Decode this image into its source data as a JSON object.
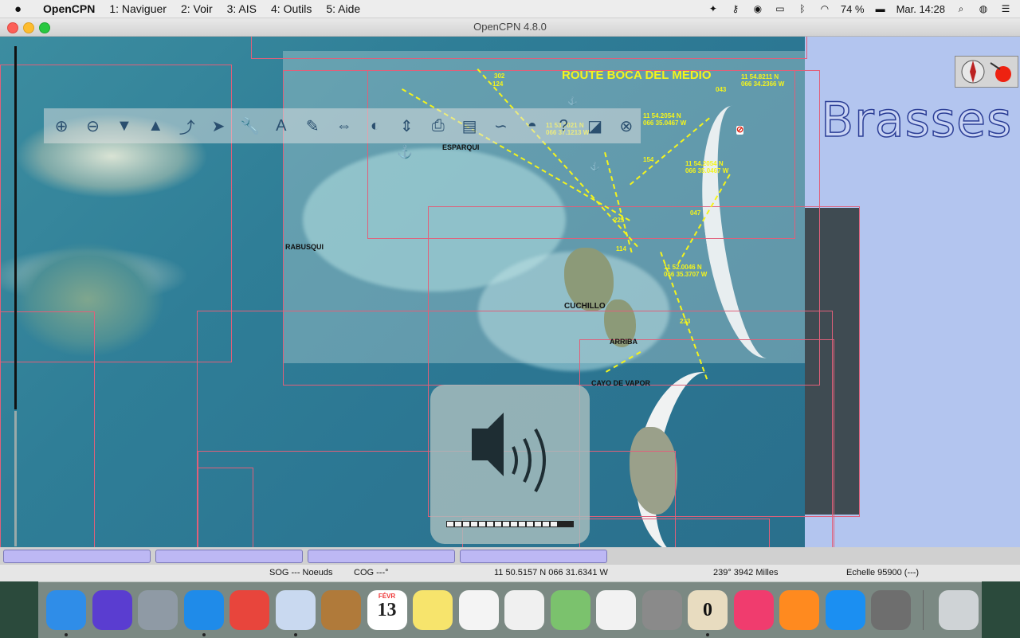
{
  "menubar": {
    "app_name": "OpenCPN",
    "items": [
      "1: Naviguer",
      "2: Voir",
      "3: AIS",
      "4: Outils",
      "5: Aide"
    ],
    "battery": "74 %",
    "clock": "Mar. 14:28"
  },
  "window": {
    "title": "OpenCPN 4.8.0"
  },
  "chart": {
    "route_name": "ROUTE BOCA DEL MEDIO",
    "depth_unit": "Brasses",
    "labels": {
      "esparqui": "ESPARQUI",
      "rabusqui": "RABUSQUI",
      "cuchillo": "CUCHILLO",
      "arriba": "ARRIBA",
      "cayo_de_vapor": "CAYO DE VAPOR"
    },
    "coords": [
      {
        "lat": "11 54.8211 N",
        "lon": "066 34.2366 W"
      },
      {
        "lat": "11 54.2054 N",
        "lon": "066 35.0467 W"
      },
      {
        "lat": "11 52.0046 N",
        "lon": "066 35.3707 W"
      },
      {
        "lat": "11 53.7021 N",
        "lon": "066 37.1213 W"
      },
      {
        "lat": "11 54.2054 N",
        "lon": "066 35.0467 W"
      }
    ],
    "leg_labels": [
      "302",
      "124",
      "225",
      "047",
      "114",
      "233",
      "043",
      "154"
    ]
  },
  "toolbar": {
    "tools": [
      {
        "name": "zoom-in-icon",
        "glyph": "⊕"
      },
      {
        "name": "zoom-out-icon",
        "glyph": "⊖"
      },
      {
        "name": "scale-down-icon",
        "glyph": "▼"
      },
      {
        "name": "scale-up-icon",
        "glyph": "▲"
      },
      {
        "name": "route-icon",
        "glyph": "⤴"
      },
      {
        "name": "auto-follow-icon",
        "glyph": "➤"
      },
      {
        "name": "settings-icon",
        "glyph": "🔧"
      },
      {
        "name": "text-icon",
        "glyph": "A"
      },
      {
        "name": "current-icon",
        "glyph": "✎"
      },
      {
        "name": "measure-icon",
        "glyph": "⇔"
      },
      {
        "name": "tide-icon",
        "glyph": "◐"
      },
      {
        "name": "north-up-icon",
        "glyph": "⇕"
      },
      {
        "name": "print-icon",
        "glyph": "⎙"
      },
      {
        "name": "route-manager-icon",
        "glyph": "▤"
      },
      {
        "name": "track-icon",
        "glyph": "∽"
      },
      {
        "name": "color-scheme-icon",
        "glyph": "◓"
      },
      {
        "name": "help-icon",
        "glyph": "?"
      },
      {
        "name": "toggle-icon",
        "glyph": "◪"
      },
      {
        "name": "mob-icon",
        "glyph": "⊗"
      }
    ]
  },
  "volume": {
    "level": 0.86,
    "segments": 16,
    "filled": 14
  },
  "status": {
    "sog": "SOG --- Noeuds",
    "cog": "COG ---°",
    "position": "11 50.5157 N   066 31.6341 W",
    "bearing": "239°  3942 Milles",
    "scale": "Echelle 95900 (---)"
  },
  "dock": {
    "apps": [
      {
        "name": "finder",
        "label": "",
        "color": "#2f8de8"
      },
      {
        "name": "siri",
        "label": "",
        "color": "#5a3dd0"
      },
      {
        "name": "launchpad",
        "label": "",
        "color": "#8f9aa5"
      },
      {
        "name": "safari",
        "label": "",
        "color": "#1f8be9"
      },
      {
        "name": "chrome",
        "label": "",
        "color": "#e8453c"
      },
      {
        "name": "mail",
        "label": "",
        "color": "#c9d9f0"
      },
      {
        "name": "contacts",
        "label": "",
        "color": "#b07a3a"
      },
      {
        "name": "calendar",
        "label": "13",
        "color": "#ffffff",
        "month": "FÉVR"
      },
      {
        "name": "notes",
        "label": "",
        "color": "#f7e46c"
      },
      {
        "name": "reminders",
        "label": "",
        "color": "#f4f4f4"
      },
      {
        "name": "textedit",
        "label": "",
        "color": "#f0f0f0"
      },
      {
        "name": "maps",
        "label": "",
        "color": "#7bc26d"
      },
      {
        "name": "photos",
        "label": "",
        "color": "#f2f2f2"
      },
      {
        "name": "calculator",
        "label": "",
        "color": "#8a8a8a"
      },
      {
        "name": "opencpn",
        "label": "0",
        "color": "#e8dcc0"
      },
      {
        "name": "itunes",
        "label": "",
        "color": "#f03c6e"
      },
      {
        "name": "books",
        "label": "",
        "color": "#ff8a1f"
      },
      {
        "name": "app-store",
        "label": "",
        "color": "#1b8ff2"
      },
      {
        "name": "system-preferences",
        "label": "",
        "color": "#6e6e6e"
      },
      {
        "name": "trash",
        "label": "",
        "color": "#cfd3d6"
      }
    ]
  }
}
